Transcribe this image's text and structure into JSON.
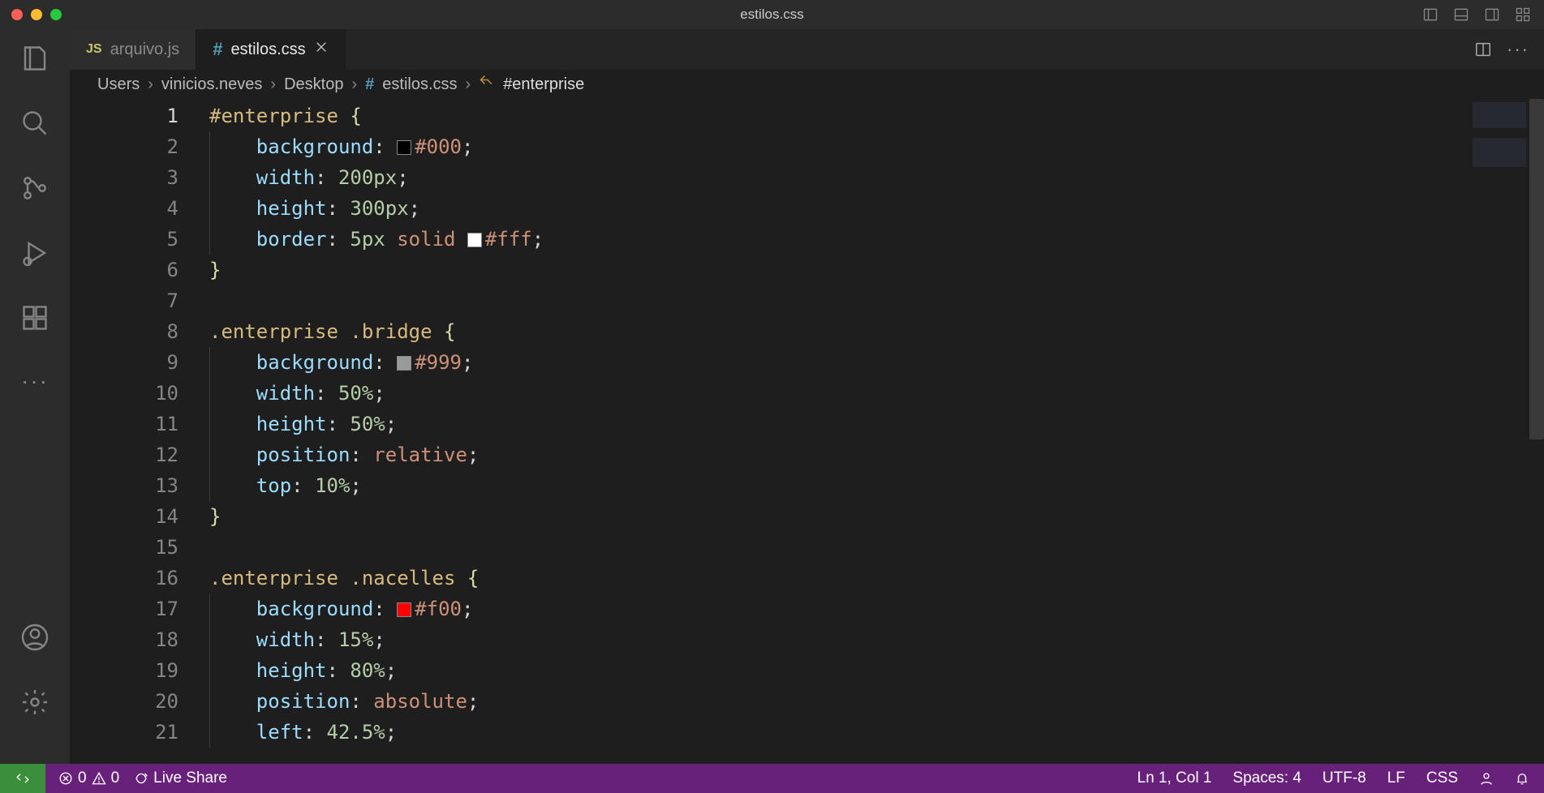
{
  "title": "estilos.css",
  "tabs": [
    {
      "icon": "JS",
      "label": "arquivo.js"
    },
    {
      "icon": "#",
      "label": "estilos.css"
    }
  ],
  "breadcrumbs": {
    "parts": [
      "Users",
      "vinicios.neves",
      "Desktop",
      "estilos.css",
      "#enterprise"
    ]
  },
  "code": {
    "line_numbers": [
      "1",
      "2",
      "3",
      "4",
      "5",
      "6",
      "7",
      "8",
      "9",
      "10",
      "11",
      "12",
      "13",
      "14",
      "15",
      "16",
      "17",
      "18",
      "19",
      "20",
      "21"
    ],
    "lines": [
      {
        "type": "sel",
        "selector": "#enterprise",
        "open": "{"
      },
      {
        "type": "decl",
        "prop": "background",
        "swatch": "000",
        "hex": "#000"
      },
      {
        "type": "decl",
        "prop": "width",
        "num": "200px"
      },
      {
        "type": "decl",
        "prop": "height",
        "num": "300px"
      },
      {
        "type": "decl_border",
        "prop": "border",
        "num": "5px",
        "kw": "solid",
        "swatch": "fff",
        "hex": "#fff"
      },
      {
        "type": "close"
      },
      {
        "type": "blank"
      },
      {
        "type": "sel",
        "selector": ".enterprise .bridge",
        "open": "{"
      },
      {
        "type": "decl",
        "prop": "background",
        "swatch": "999",
        "hex": "#999"
      },
      {
        "type": "decl",
        "prop": "width",
        "num": "50%"
      },
      {
        "type": "decl",
        "prop": "height",
        "num": "50%"
      },
      {
        "type": "decl",
        "prop": "position",
        "kw": "relative"
      },
      {
        "type": "decl",
        "prop": "top",
        "num": "10%"
      },
      {
        "type": "close"
      },
      {
        "type": "blank"
      },
      {
        "type": "sel",
        "selector": ".enterprise .nacelles",
        "open": "{"
      },
      {
        "type": "decl",
        "prop": "background",
        "swatch": "f00",
        "hex": "#f00"
      },
      {
        "type": "decl",
        "prop": "width",
        "num": "15%"
      },
      {
        "type": "decl",
        "prop": "height",
        "num": "80%"
      },
      {
        "type": "decl",
        "prop": "position",
        "kw": "absolute"
      },
      {
        "type": "decl",
        "prop": "left",
        "num": "42.5%"
      }
    ]
  },
  "status": {
    "errors": "0",
    "warnings": "0",
    "live_share": "Live Share",
    "cursor": "Ln 1, Col 1",
    "spaces": "Spaces: 4",
    "encoding": "UTF-8",
    "eol": "LF",
    "language": "CSS"
  }
}
